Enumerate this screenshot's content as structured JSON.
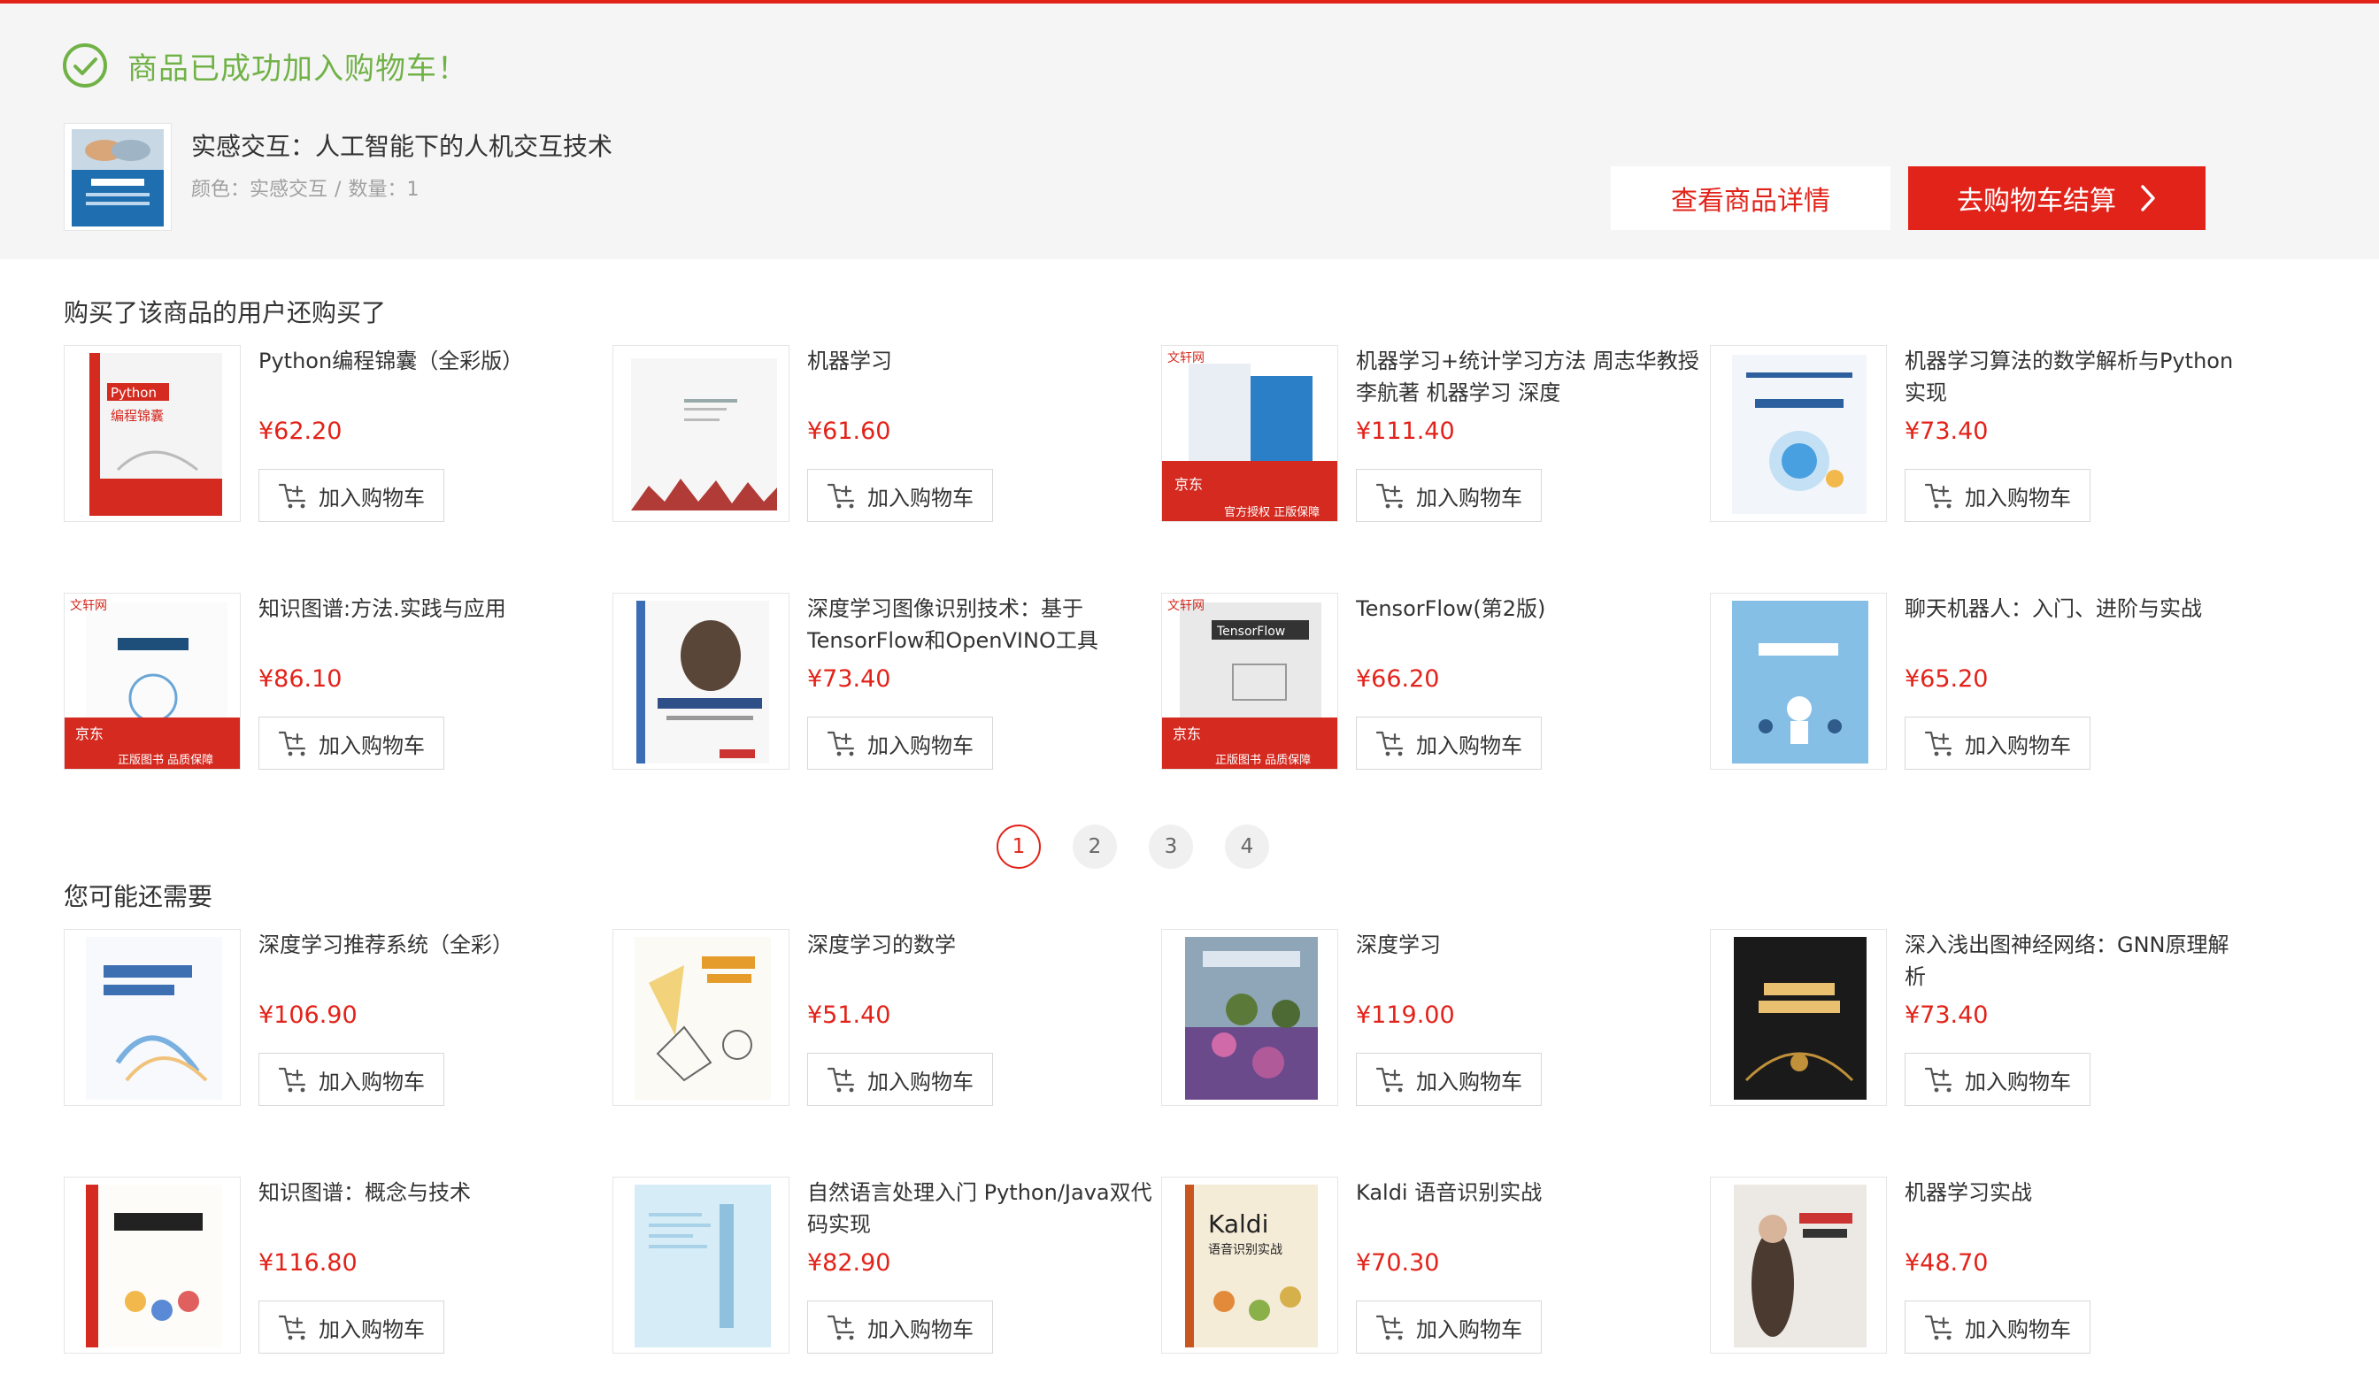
{
  "banner": {
    "success_text": "商品已成功加入购物车！",
    "product_title": "实感交互：人工智能下的人机交互技术",
    "color_label": "颜色：实感交互",
    "separator": "/",
    "quantity_label": "数量：1",
    "detail_button": "查看商品详情",
    "cart_button": "去购物车结算"
  },
  "sections": {
    "also_bought_title": "购买了该商品的用户还购买了",
    "may_need_title": "您可能还需要"
  },
  "add_to_cart_label": "加入购物车",
  "also_bought": [
    {
      "name": "Python编程锦囊（全彩版）",
      "price": "¥62.20"
    },
    {
      "name": "机器学习",
      "price": "¥61.60"
    },
    {
      "name": "机器学习+统计学习方法 周志华教授 李航著 机器学习 深度",
      "price": "¥111.40"
    },
    {
      "name": "机器学习算法的数学解析与Python实现",
      "price": "¥73.40"
    },
    {
      "name": "知识图谱:方法.实践与应用",
      "price": "¥86.10"
    },
    {
      "name": "深度学习图像识别技术：基于TensorFlow和OpenVINO工具",
      "price": "¥73.40"
    },
    {
      "name": "TensorFlow(第2版)",
      "price": "¥66.20"
    },
    {
      "name": "聊天机器人：入门、进阶与实战",
      "price": "¥65.20"
    }
  ],
  "pagination": {
    "pages": [
      "1",
      "2",
      "3",
      "4"
    ],
    "current": "1"
  },
  "may_need": [
    {
      "name": "深度学习推荐系统（全彩）",
      "price": "¥106.90"
    },
    {
      "name": "深度学习的数学",
      "price": "¥51.40"
    },
    {
      "name": "深度学习",
      "price": "¥119.00"
    },
    {
      "name": "深入浅出图神经网络：GNN原理解析",
      "price": "¥73.40"
    },
    {
      "name": "知识图谱：概念与技术",
      "price": "¥116.80"
    },
    {
      "name": "自然语言处理入门 Python/Java双代码实现",
      "price": "¥82.90"
    },
    {
      "name": "Kaldi 语音识别实战",
      "price": "¥70.30"
    },
    {
      "name": "机器学习实战",
      "price": "¥48.70"
    }
  ],
  "cover_text": {
    "python": "Python",
    "python_sub": "编程锦囊",
    "jd_badge": "京东",
    "official": "官方授权 正版保障",
    "zhengban": "正版图书 品质保障",
    "tensorflow": "TensorFlow",
    "kaldi": "Kaldi",
    "kaldi_sub": "语音识别实战"
  },
  "colors": {
    "accent": "#e2231a",
    "success": "#71b247"
  }
}
